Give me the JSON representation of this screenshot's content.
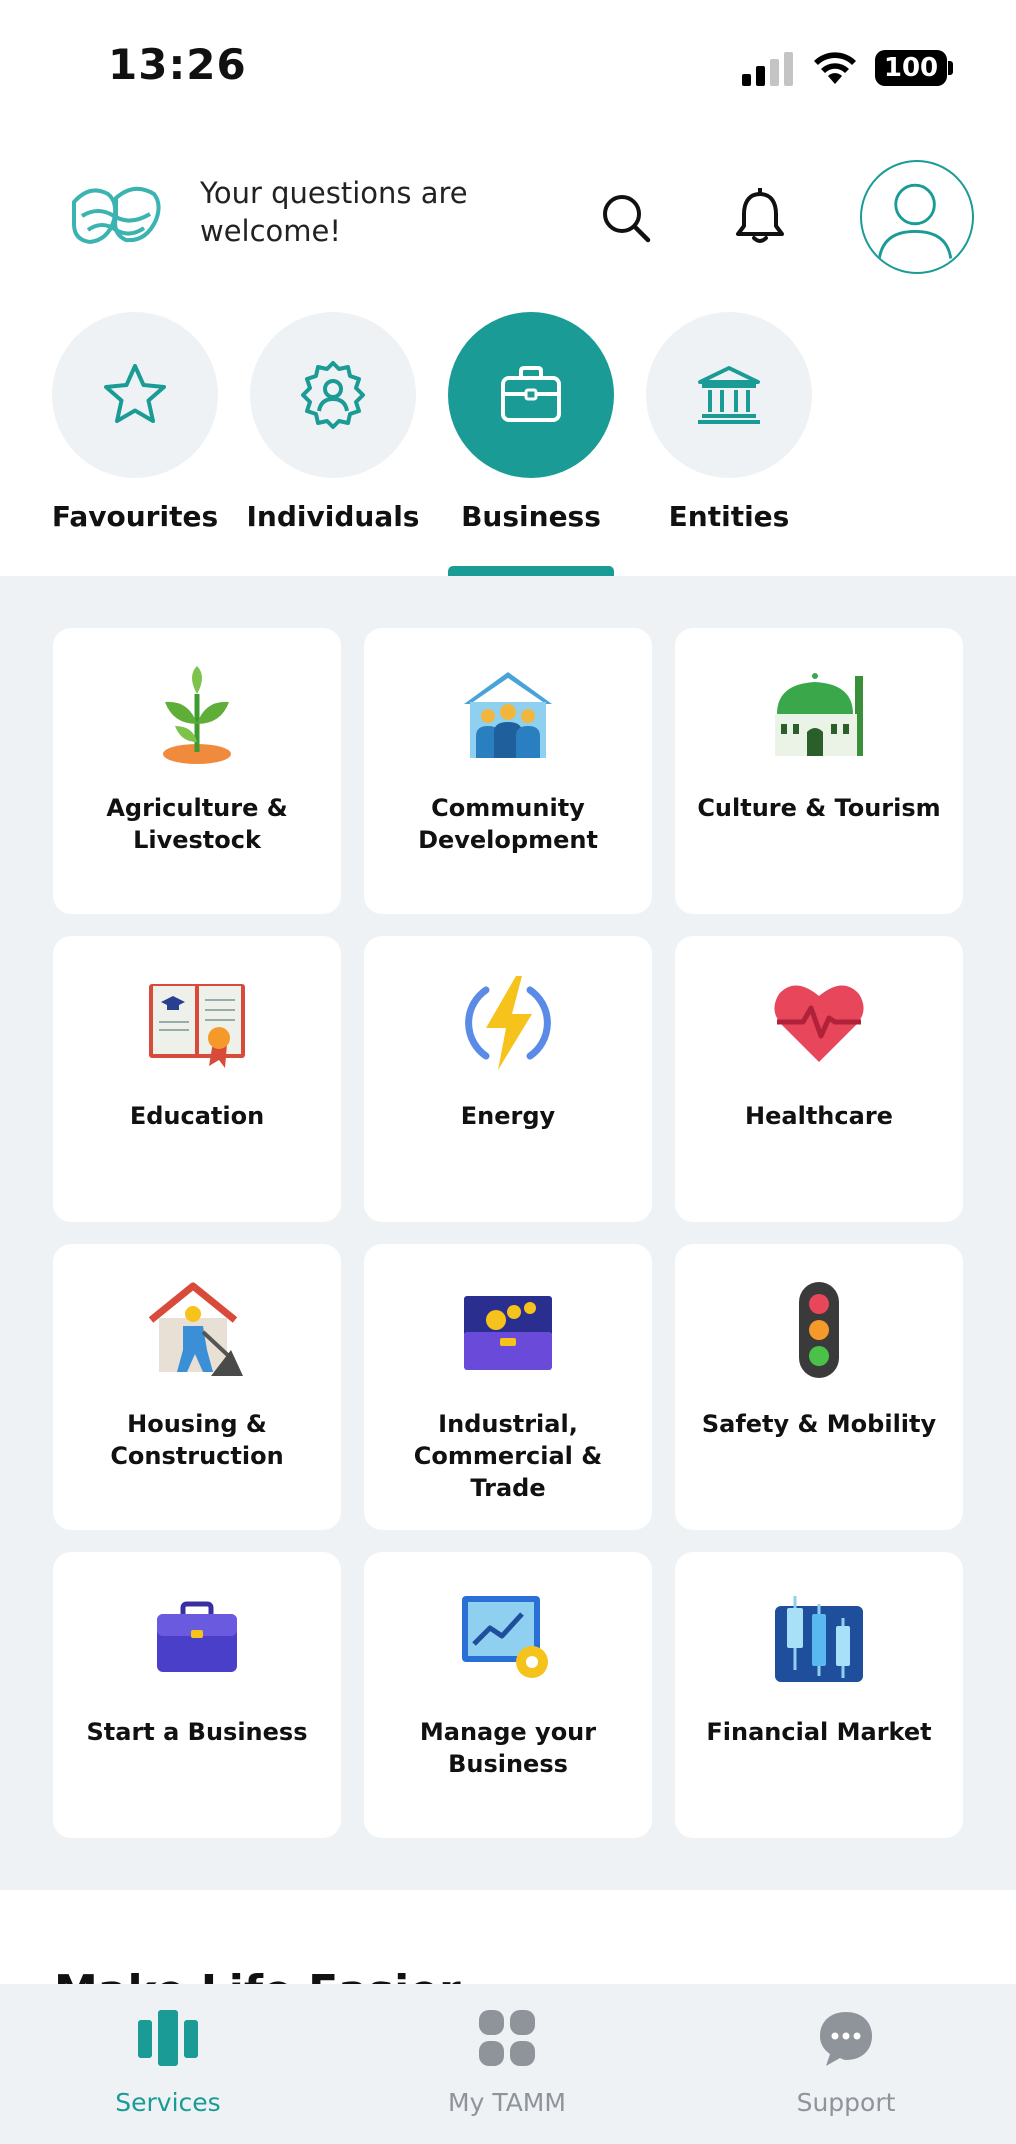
{
  "status": {
    "time": "13:26",
    "battery": "100"
  },
  "header": {
    "welcome": "Your questions are welcome!"
  },
  "tabs": [
    {
      "label": "Favourites",
      "icon": "star-icon",
      "active": false
    },
    {
      "label": "Individuals",
      "icon": "person-gear-icon",
      "active": false
    },
    {
      "label": "Business",
      "icon": "briefcase-icon",
      "active": true
    },
    {
      "label": "Entities",
      "icon": "institution-icon",
      "active": false
    }
  ],
  "categories": [
    {
      "label": "Agriculture & Livestock",
      "icon": "sprout-icon"
    },
    {
      "label": "Community Development",
      "icon": "community-house-icon"
    },
    {
      "label": "Culture & Tourism",
      "icon": "mosque-icon"
    },
    {
      "label": "Education",
      "icon": "book-icon"
    },
    {
      "label": "Energy",
      "icon": "lightning-icon"
    },
    {
      "label": "Healthcare",
      "icon": "heart-pulse-icon"
    },
    {
      "label": "Housing & Construction",
      "icon": "construction-worker-icon"
    },
    {
      "label": "Industrial, Commercial & Trade",
      "icon": "toolbox-icon"
    },
    {
      "label": "Safety & Mobility",
      "icon": "traffic-light-icon"
    },
    {
      "label": "Start a Business",
      "icon": "briefcase-icon"
    },
    {
      "label": "Manage your Business",
      "icon": "chart-gear-icon"
    },
    {
      "label": "Financial Market",
      "icon": "candlestick-chart-icon"
    }
  ],
  "section_peek": "Make Life Easier",
  "bottom_nav": [
    {
      "label": "Services",
      "icon": "services-icon",
      "active": true
    },
    {
      "label": "My TAMM",
      "icon": "grid-icon",
      "active": false
    },
    {
      "label": "Support",
      "icon": "chat-bubble-icon",
      "active": false
    }
  ],
  "colors": {
    "accent": "#1a9b95",
    "background": "#eef2f4"
  }
}
